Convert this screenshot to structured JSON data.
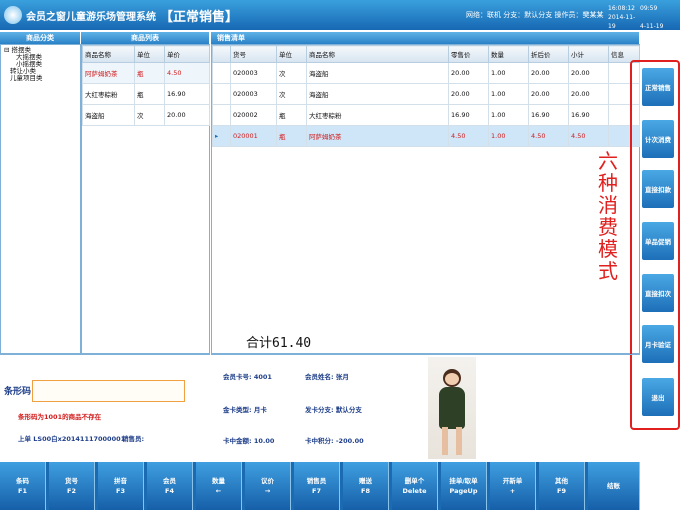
{
  "header": {
    "app_title": "会员之窗儿童游乐场管理系统",
    "page_title": "【正常销售】",
    "info": "网络：联机 分支：默认分支 操作员：樊某某",
    "time": "16:08:12",
    "date": "2014-11-19",
    "time2": "09:59",
    "date2": "4-11-19"
  },
  "category_panel": {
    "title": "商品分类",
    "tree": [
      "搭摆类",
      "大摇摆类",
      "小摇摆类",
      "转让小类",
      "儿童项目类"
    ]
  },
  "product_panel": {
    "title": "商品列表",
    "columns": [
      "商品名称",
      "单位",
      "单价"
    ],
    "rows": [
      {
        "name": "阿萨姆奶茶",
        "unit": "瓶",
        "price": "4.50",
        "red": true
      },
      {
        "name": "大红枣粽粉",
        "unit": "瓶",
        "price": "16.90",
        "red": false
      },
      {
        "name": "海盗船",
        "unit": "次",
        "price": "20.00",
        "red": false
      }
    ]
  },
  "sales_panel": {
    "title": "销售清单",
    "columns": [
      "货号",
      "单位",
      "商品名称",
      "零售价",
      "数量",
      "折后价",
      "小计",
      "信息"
    ],
    "rows": [
      {
        "code": "020003",
        "unit": "次",
        "name": "海盗船",
        "retail": "20.00",
        "qty": "1.00",
        "disc": "20.00",
        "sub": "20.00",
        "info": ""
      },
      {
        "code": "020003",
        "unit": "次",
        "name": "海盗船",
        "retail": "20.00",
        "qty": "1.00",
        "disc": "20.00",
        "sub": "20.00",
        "info": ""
      },
      {
        "code": "020002",
        "unit": "瓶",
        "name": "大红枣粽粉",
        "retail": "16.90",
        "qty": "1.00",
        "disc": "16.90",
        "sub": "16.90",
        "info": ""
      },
      {
        "code": "020001",
        "unit": "瓶",
        "name": "阿萨姆奶茶",
        "retail": "4.50",
        "qty": "1.00",
        "disc": "4.50",
        "sub": "4.50",
        "info": ""
      }
    ],
    "total": "合计61.40"
  },
  "barcode": {
    "label": "条形码",
    "value": "",
    "error": "条形码为1001的商品不存在",
    "last_order_label": "上单 LS00白x20141117000001",
    "seller_label": "销售员:"
  },
  "member": {
    "card_no": "会员卡号: 4001",
    "name": "会员姓名: 张月",
    "card_type": "金卡类型: 月卡",
    "branch": "发卡分支: 默认分支",
    "balance": "卡中金额: 10.00",
    "points": "卡中积分: -200.00"
  },
  "side_buttons": [
    "正常销售",
    "计次消费",
    "直接扣款",
    "单品促销",
    "直接扣次",
    "月卡验证",
    "退出"
  ],
  "annotation": "六种消费模式",
  "annotation_color": "#e0201e",
  "toolbar": [
    {
      "label": "条码",
      "key": "F1"
    },
    {
      "label": "货号",
      "key": "F2"
    },
    {
      "label": "拼音",
      "key": "F3"
    },
    {
      "label": "会员",
      "key": "F4"
    },
    {
      "label": "数量",
      "key": "←"
    },
    {
      "label": "议价",
      "key": "→"
    },
    {
      "label": "销售员",
      "key": "F7"
    },
    {
      "label": "赠送",
      "key": "F8"
    },
    {
      "label": "删单个",
      "key": "Delete"
    },
    {
      "label": "挂单/取单",
      "key": "PageUp"
    },
    {
      "label": "开新单",
      "key": "+"
    },
    {
      "label": "其他",
      "key": "F9"
    },
    {
      "label": "结账",
      "key": ""
    }
  ]
}
